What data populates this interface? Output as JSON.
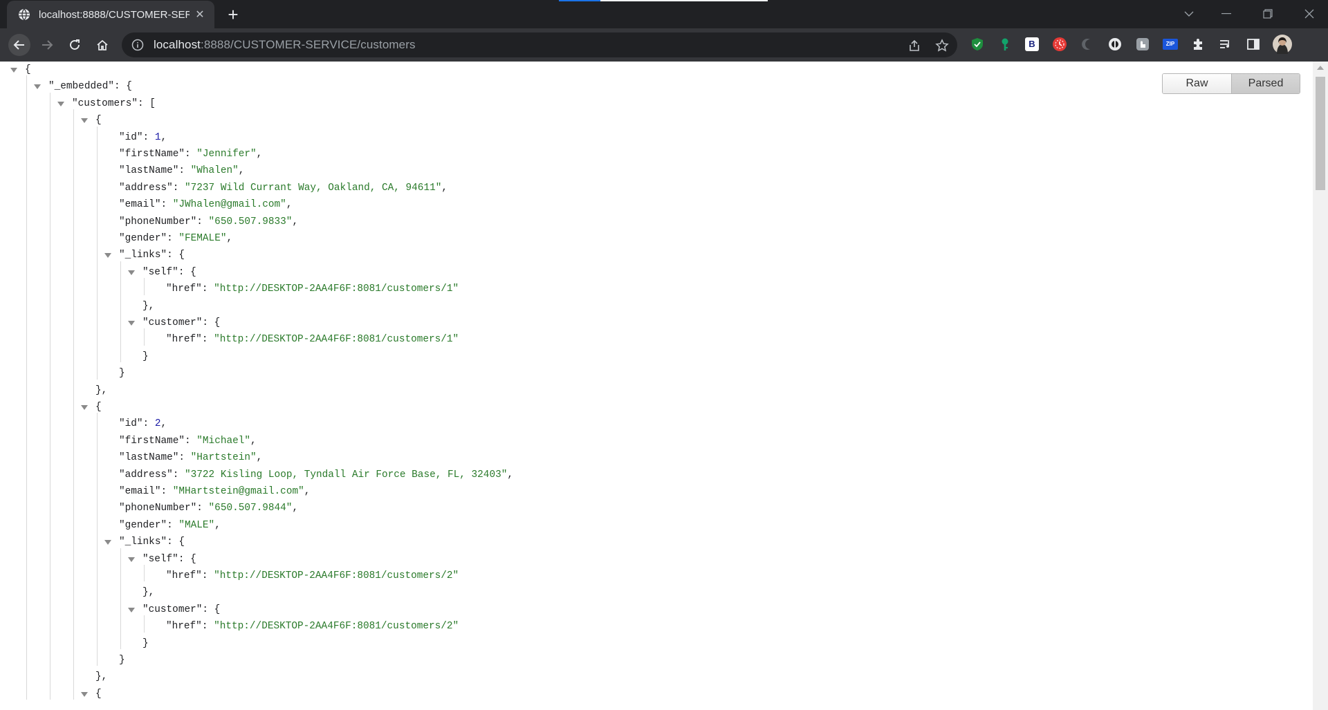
{
  "browser": {
    "tab": {
      "title": "localhost:8888/CUSTOMER-SERVICE/customers",
      "favicon": "globe-icon"
    },
    "url": {
      "host": "localhost",
      "path": ":8888/CUSTOMER-SERVICE/customers"
    },
    "icons": [
      "globe-icon",
      "close-icon",
      "plus-icon",
      "chevron-down-icon",
      "minimize-icon",
      "restore-icon",
      "close-window-icon",
      "back-arrow-icon",
      "forward-arrow-icon",
      "reload-icon",
      "home-icon",
      "info-icon",
      "share-icon",
      "star-icon",
      "puzzle-icon",
      "playlist-icon",
      "sidepanel-icon",
      "avatar"
    ],
    "extensions": [
      {
        "name": "shield-extension-icon",
        "color": "#1e8e3e"
      },
      {
        "name": "key-extension-icon",
        "color": "#12a36a"
      },
      {
        "name": "b-extension-icon",
        "color": "#ffffff",
        "label": "B"
      },
      {
        "name": "clock-extension-icon",
        "color": "#e53935"
      },
      {
        "name": "crescent-extension-icon",
        "color": "#5f6368"
      },
      {
        "name": "circle-extension-icon",
        "color": "#e8eaed"
      },
      {
        "name": "hand-extension-icon",
        "color": "#9aa0a6"
      },
      {
        "name": "zip-extension-icon",
        "color": "#1a56db",
        "label": "ZIP"
      }
    ]
  },
  "viewer": {
    "raw_label": "Raw",
    "parsed_label": "Parsed",
    "active_view": "Parsed"
  },
  "json": {
    "lines": [
      [
        {
          "p": "{"
        }
      ],
      [
        {
          "k": "\"_embedded\""
        },
        {
          "p": ": {"
        }
      ],
      [
        {
          "k": "\"customers\""
        },
        {
          "p": ": ["
        }
      ],
      [
        {
          "p": "{"
        }
      ],
      [
        {
          "k": "\"id\""
        },
        {
          "p": ": "
        },
        {
          "n": "1"
        },
        {
          "p": ","
        }
      ],
      [
        {
          "k": "\"firstName\""
        },
        {
          "p": ": "
        },
        {
          "s": "\"Jennifer\""
        },
        {
          "p": ","
        }
      ],
      [
        {
          "k": "\"lastName\""
        },
        {
          "p": ": "
        },
        {
          "s": "\"Whalen\""
        },
        {
          "p": ","
        }
      ],
      [
        {
          "k": "\"address\""
        },
        {
          "p": ": "
        },
        {
          "s": "\"7237 Wild Currant Way, Oakland, CA, 94611\""
        },
        {
          "p": ","
        }
      ],
      [
        {
          "k": "\"email\""
        },
        {
          "p": ": "
        },
        {
          "s": "\"JWhalen@gmail.com\""
        },
        {
          "p": ","
        }
      ],
      [
        {
          "k": "\"phoneNumber\""
        },
        {
          "p": ": "
        },
        {
          "s": "\"650.507.9833\""
        },
        {
          "p": ","
        }
      ],
      [
        {
          "k": "\"gender\""
        },
        {
          "p": ": "
        },
        {
          "s": "\"FEMALE\""
        },
        {
          "p": ","
        }
      ],
      [
        {
          "k": "\"_links\""
        },
        {
          "p": ": {"
        }
      ],
      [
        {
          "k": "\"self\""
        },
        {
          "p": ": {"
        }
      ],
      [
        {
          "k": "\"href\""
        },
        {
          "p": ": "
        },
        {
          "s": "\"http://DESKTOP-2AA4F6F:8081/customers/1\""
        }
      ],
      [
        {
          "p": "},"
        }
      ],
      [
        {
          "k": "\"customer\""
        },
        {
          "p": ": {"
        }
      ],
      [
        {
          "k": "\"href\""
        },
        {
          "p": ": "
        },
        {
          "s": "\"http://DESKTOP-2AA4F6F:8081/customers/1\""
        }
      ],
      [
        {
          "p": "}"
        }
      ],
      [
        {
          "p": "}"
        }
      ],
      [
        {
          "p": "},"
        }
      ],
      [
        {
          "p": "{"
        }
      ],
      [
        {
          "k": "\"id\""
        },
        {
          "p": ": "
        },
        {
          "n": "2"
        },
        {
          "p": ","
        }
      ],
      [
        {
          "k": "\"firstName\""
        },
        {
          "p": ": "
        },
        {
          "s": "\"Michael\""
        },
        {
          "p": ","
        }
      ],
      [
        {
          "k": "\"lastName\""
        },
        {
          "p": ": "
        },
        {
          "s": "\"Hartstein\""
        },
        {
          "p": ","
        }
      ],
      [
        {
          "k": "\"address\""
        },
        {
          "p": ": "
        },
        {
          "s": "\"3722 Kisling Loop, Tyndall Air Force Base, FL, 32403\""
        },
        {
          "p": ","
        }
      ],
      [
        {
          "k": "\"email\""
        },
        {
          "p": ": "
        },
        {
          "s": "\"MHartstein@gmail.com\""
        },
        {
          "p": ","
        }
      ],
      [
        {
          "k": "\"phoneNumber\""
        },
        {
          "p": ": "
        },
        {
          "s": "\"650.507.9844\""
        },
        {
          "p": ","
        }
      ],
      [
        {
          "k": "\"gender\""
        },
        {
          "p": ": "
        },
        {
          "s": "\"MALE\""
        },
        {
          "p": ","
        }
      ],
      [
        {
          "k": "\"_links\""
        },
        {
          "p": ": {"
        }
      ],
      [
        {
          "k": "\"self\""
        },
        {
          "p": ": {"
        }
      ],
      [
        {
          "k": "\"href\""
        },
        {
          "p": ": "
        },
        {
          "s": "\"http://DESKTOP-2AA4F6F:8081/customers/2\""
        }
      ],
      [
        {
          "p": "},"
        }
      ],
      [
        {
          "k": "\"customer\""
        },
        {
          "p": ": {"
        }
      ],
      [
        {
          "k": "\"href\""
        },
        {
          "p": ": "
        },
        {
          "s": "\"http://DESKTOP-2AA4F6F:8081/customers/2\""
        }
      ],
      [
        {
          "p": "}"
        }
      ],
      [
        {
          "p": "}"
        }
      ],
      [
        {
          "p": "},"
        }
      ],
      [
        {
          "p": "{"
        }
      ]
    ]
  }
}
